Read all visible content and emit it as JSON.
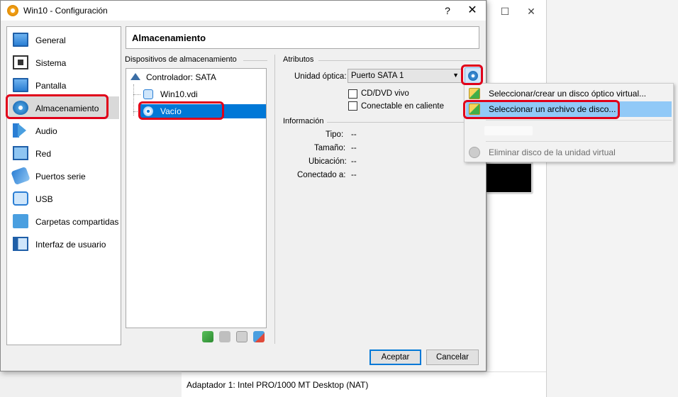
{
  "dialog": {
    "title": "Win10 - Configuración",
    "help": "?",
    "close": "✕"
  },
  "background": {
    "detail_text": "Adaptador 1:   Intel PRO/1000 MT Desktop (NAT)",
    "maximize": "☐",
    "close": "✕"
  },
  "categories": [
    {
      "label": "General",
      "icon": "monitor-icon"
    },
    {
      "label": "Sistema",
      "icon": "chip-icon"
    },
    {
      "label": "Pantalla",
      "icon": "display-icon"
    },
    {
      "label": "Almacenamiento",
      "icon": "storage-icon"
    },
    {
      "label": "Audio",
      "icon": "speaker-icon"
    },
    {
      "label": "Red",
      "icon": "network-icon"
    },
    {
      "label": "Puertos serie",
      "icon": "serial-port-icon"
    },
    {
      "label": "USB",
      "icon": "usb-icon"
    },
    {
      "label": "Carpetas compartidas",
      "icon": "shared-folder-icon"
    },
    {
      "label": "Interfaz de usuario",
      "icon": "user-interface-icon"
    }
  ],
  "selected_category": "Almacenamiento",
  "header": {
    "title": "Almacenamiento"
  },
  "storage": {
    "group_label": "Dispositivos de almacenamiento",
    "controller": "Controlador: SATA",
    "disk": "Win10.vdi",
    "optical": "Vacío"
  },
  "attributes": {
    "group_label": "Atributos",
    "optical_label": "Unidad óptica:",
    "optical_value": "Puerto SATA 1",
    "live_cd": "CD/DVD vivo",
    "hot_plug": "Conectable en caliente"
  },
  "info": {
    "group_label": "Información",
    "rows": [
      {
        "label": "Tipo:",
        "value": "--"
      },
      {
        "label": "Tamaño:",
        "value": "--"
      },
      {
        "label": "Ubicación:",
        "value": "--"
      },
      {
        "label": "Conectado a:",
        "value": "--"
      }
    ]
  },
  "buttons": {
    "ok": "Aceptar",
    "cancel": "Cancelar"
  },
  "menu": {
    "items": [
      {
        "label": "Seleccionar/crear un disco óptico virtual...",
        "enabled": true
      },
      {
        "label": "Seleccionar un archivo de disco...",
        "enabled": true,
        "highlighted": true
      },
      {
        "label": "Eliminar disco de la unidad virtual",
        "enabled": false
      }
    ]
  },
  "colors": {
    "selection": "#0078d7",
    "annotation": "#e0001a",
    "menu_highlight": "#91c9f7"
  }
}
